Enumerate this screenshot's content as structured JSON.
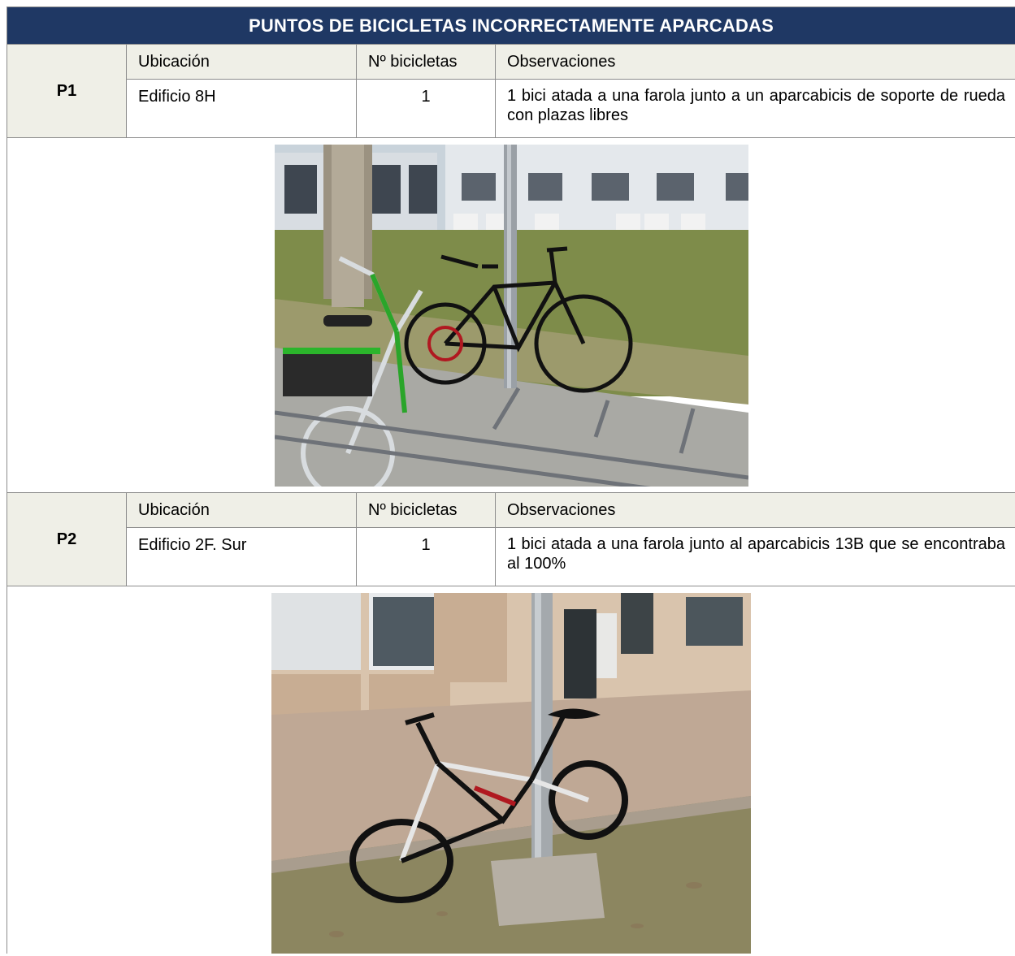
{
  "title": "PUNTOS DE BICICLETAS INCORRECTAMENTE APARCADAS",
  "headers": {
    "location": "Ubicación",
    "count": "Nº bicicletas",
    "notes": "Observaciones"
  },
  "points": [
    {
      "id": "P1",
      "location": "Edificio 8H",
      "count": "1",
      "notes": "1 bici atada a una farola junto a un aparcabicis de soporte de rueda con plazas libres",
      "photo": {
        "subject": "bicycle-locked-to-lamppost-near-rack"
      }
    },
    {
      "id": "P2",
      "location": "Edificio 2F. Sur",
      "count": "1",
      "notes": "1 bici atada a una farola junto al aparcabicis 13B que se encontraba al 100%",
      "photo": {
        "subject": "bicycle-locked-to-lamppost-on-sidewalk"
      }
    }
  ],
  "colors": {
    "title_bg": "#1f3864",
    "header_bg": "#efefe7",
    "border": "#8c8c8c"
  }
}
